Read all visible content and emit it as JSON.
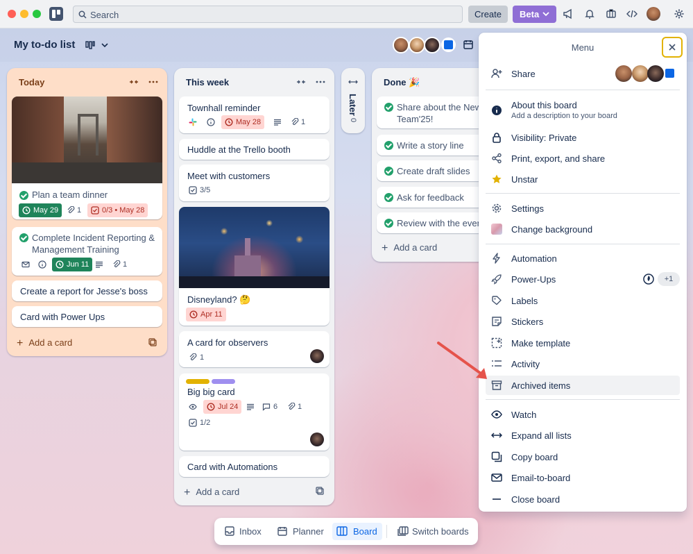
{
  "topbar": {
    "search_placeholder": "Search",
    "create_label": "Create",
    "beta_label": "Beta"
  },
  "board": {
    "title": "My to-do list"
  },
  "lists": [
    {
      "title": "Today",
      "cards": [
        {
          "title": "Plan a team dinner",
          "date": "May 29",
          "attachments": "1",
          "checklist": "0/3 • May 28"
        },
        {
          "title": "Complete Incident Reporting & Management Training",
          "date": "Jun 11",
          "attachments": "1"
        },
        {
          "title": "Create a report for Jesse's boss"
        },
        {
          "title": "Card with Power Ups"
        }
      ],
      "add_label": "Add a card"
    },
    {
      "title": "This week",
      "cards": [
        {
          "title": "Townhall reminder",
          "date": "May 28",
          "attachments": "1"
        },
        {
          "title": "Huddle at the Trello booth"
        },
        {
          "title": "Meet with customers",
          "checklist": "3/5"
        },
        {
          "title": "Disneyland? 🤔",
          "date": "Apr 11"
        },
        {
          "title": "A card for observers",
          "attachments": "1"
        },
        {
          "title": "Big big card",
          "date": "Jul 24",
          "comments": "6",
          "attachments": "1",
          "checklist": "1/2"
        },
        {
          "title": "Card with Automations"
        }
      ],
      "add_label": "Add a card"
    },
    {
      "title": "Later",
      "count": "0"
    },
    {
      "title": "Done 🎉",
      "cards": [
        {
          "title": "Share about the New Team'25!"
        },
        {
          "title": "Write a story line"
        },
        {
          "title": "Create draft slides"
        },
        {
          "title": "Ask for feedback"
        },
        {
          "title": "Review with the event"
        }
      ],
      "add_label": "Add a card"
    }
  ],
  "menu": {
    "title": "Menu",
    "share": "Share",
    "about_title": "About this board",
    "about_sub": "Add a description to your board",
    "visibility": "Visibility: Private",
    "print": "Print, export, and share",
    "unstar": "Unstar",
    "settings": "Settings",
    "change_bg": "Change background",
    "automation": "Automation",
    "powerups": "Power-Ups",
    "powerups_extra": "+1",
    "labels": "Labels",
    "stickers": "Stickers",
    "make_template": "Make template",
    "activity": "Activity",
    "archived": "Archived items",
    "watch": "Watch",
    "expand": "Expand all lists",
    "copy": "Copy board",
    "email": "Email-to-board",
    "close": "Close board"
  },
  "bottom_nav": {
    "inbox": "Inbox",
    "planner": "Planner",
    "board": "Board",
    "switch": "Switch boards"
  },
  "colors": {
    "accent": "#0c66e4",
    "beta": "#8f6ed5",
    "green": "#1f845a",
    "red_bg": "#ffd5d2",
    "today_list": "#fedec8"
  }
}
